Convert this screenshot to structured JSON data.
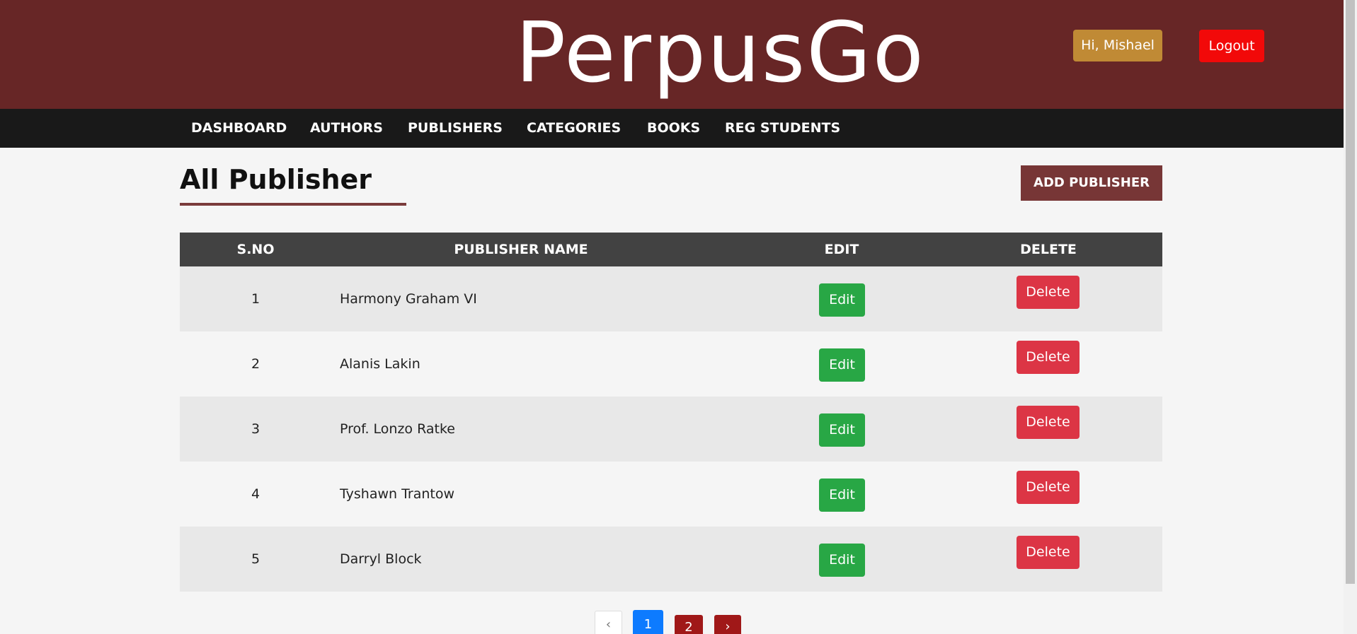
{
  "header": {
    "logo": "PerpusGo",
    "greeting": "Hi, Mishael",
    "logout_label": "Logout"
  },
  "nav": {
    "items": [
      "DASHBOARD",
      "AUTHORS",
      "PUBLISHERS",
      "CATEGORIES",
      "BOOKS",
      "REG STUDENTS"
    ]
  },
  "main": {
    "title": "All Publisher",
    "add_button": "ADD PUBLISHER"
  },
  "table": {
    "headers": [
      "S.NO",
      "PUBLISHER NAME",
      "EDIT",
      "DELETE"
    ],
    "rows": [
      {
        "no": "1",
        "name": "Harmony Graham VI",
        "edit": "Edit",
        "delete": "Delete"
      },
      {
        "no": "2",
        "name": "Alanis Lakin",
        "edit": "Edit",
        "delete": "Delete"
      },
      {
        "no": "3",
        "name": "Prof. Lonzo Ratke",
        "edit": "Edit",
        "delete": "Delete"
      },
      {
        "no": "4",
        "name": "Tyshawn Trantow",
        "edit": "Edit",
        "delete": "Delete"
      },
      {
        "no": "5",
        "name": "Darryl Block",
        "edit": "Edit",
        "delete": "Delete"
      }
    ]
  },
  "pagination": {
    "prev": "‹",
    "pages": [
      "1",
      "2"
    ],
    "next": "›",
    "current": "1"
  },
  "colors": {
    "header_bg": "#672626",
    "nav_bg": "#191919",
    "accent": "#773636",
    "edit": "#28a745",
    "delete": "#dc3545",
    "logout": "#f20909",
    "greeting": "#c08a35"
  }
}
